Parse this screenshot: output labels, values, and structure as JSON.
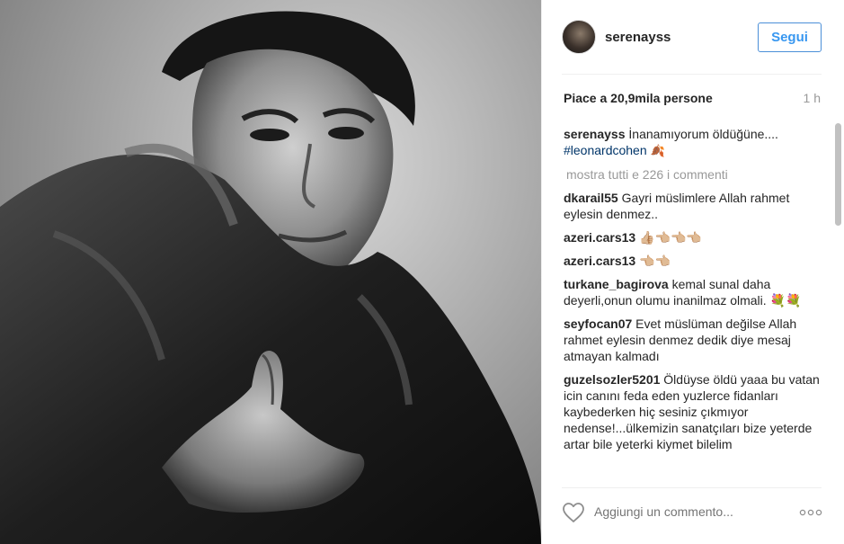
{
  "post": {
    "photo_alt": "Black and white portrait photo",
    "header": {
      "username": "serenayss",
      "follow_label": "Segui"
    },
    "likes_text": "Piace a 20,9mila persone",
    "time_ago": "1 h",
    "caption": {
      "user": "serenayss",
      "text": "İnanamıyorum öldüğüne....",
      "hashtag": "#leonardcohen",
      "emoji": "🍂"
    },
    "view_all_label": "mostra tutti e 226 i commenti",
    "comments": [
      {
        "user": "dkarail55",
        "text": "Gayri müslimlere Allah rahmet eylesin denmez.."
      },
      {
        "user": "azeri.cars13",
        "text": "👍🏼👈🏼👈🏼👈🏼"
      },
      {
        "user": "azeri.cars13",
        "text": "👈🏼👈🏼"
      },
      {
        "user": "turkane_bagirova",
        "text": "kemal sunal daha deyerli,onun olumu inanilmaz olmali. 💐💐"
      },
      {
        "user": "seyfocan07",
        "text": "Evet müslüman değilse Allah rahmet eylesin denmez dedik diye mesaj atmayan kalmadı"
      },
      {
        "user": "guzelsozler5201",
        "text": "Öldüyse öldü yaaa bu vatan icin canını feda eden yuzlerce fidanları kaybederken hiç sesiniz çıkmıyor nedense!...ülkemizin sanatçıları bize yeterde artar bile yeterki kiymet bilelim"
      }
    ],
    "add_comment_placeholder": "Aggiungi un commento...",
    "icons": {
      "like": "heart-icon",
      "options": "more-options-icon"
    },
    "colors": {
      "link_blue": "#3897f0",
      "hashtag": "#003569",
      "muted": "#999999"
    }
  }
}
